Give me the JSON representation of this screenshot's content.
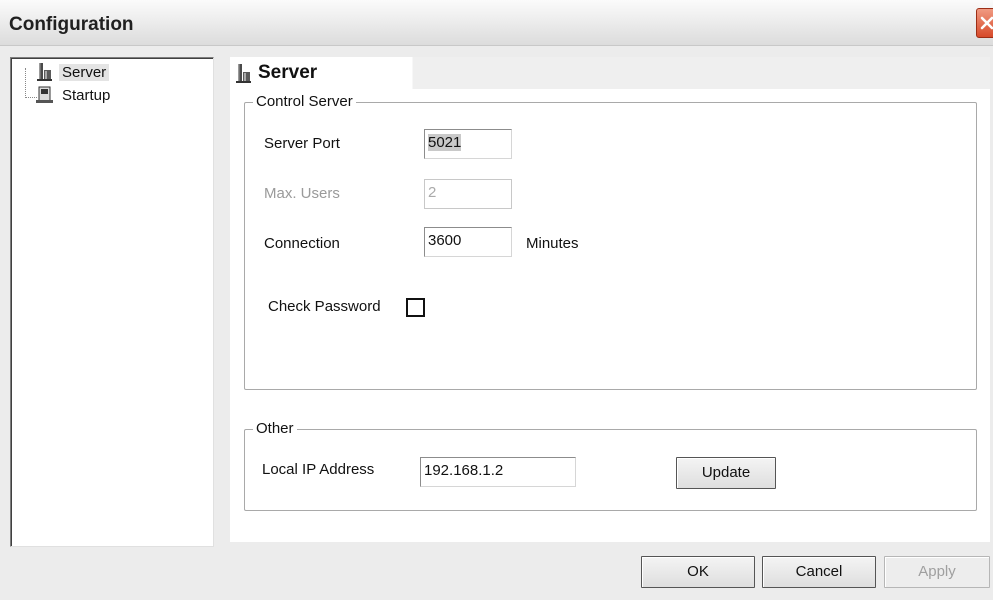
{
  "window": {
    "title": "Configuration",
    "close_icon": "close-icon"
  },
  "tree": {
    "items": [
      {
        "label": "Server",
        "icon": "server-icon",
        "selected": true
      },
      {
        "label": "Startup",
        "icon": "startup-icon",
        "selected": false
      }
    ]
  },
  "page": {
    "title": "Server",
    "control_server": {
      "legend": "Control Server",
      "server_port_label": "Server Port",
      "server_port_value": "5021",
      "max_users_label": "Max. Users",
      "max_users_value": "2",
      "connection_label": "Connection",
      "connection_value": "3600",
      "connection_unit": "Minutes",
      "check_password_label": "Check Password",
      "check_password_checked": false
    },
    "other": {
      "legend": "Other",
      "local_ip_label": "Local IP Address",
      "local_ip_value": "192.168.1.2",
      "update_button": "Update"
    }
  },
  "footer": {
    "ok": "OK",
    "cancel": "Cancel",
    "apply": "Apply"
  },
  "colors": {
    "close_button": "#d74a2a",
    "window_bg": "#ececec"
  }
}
